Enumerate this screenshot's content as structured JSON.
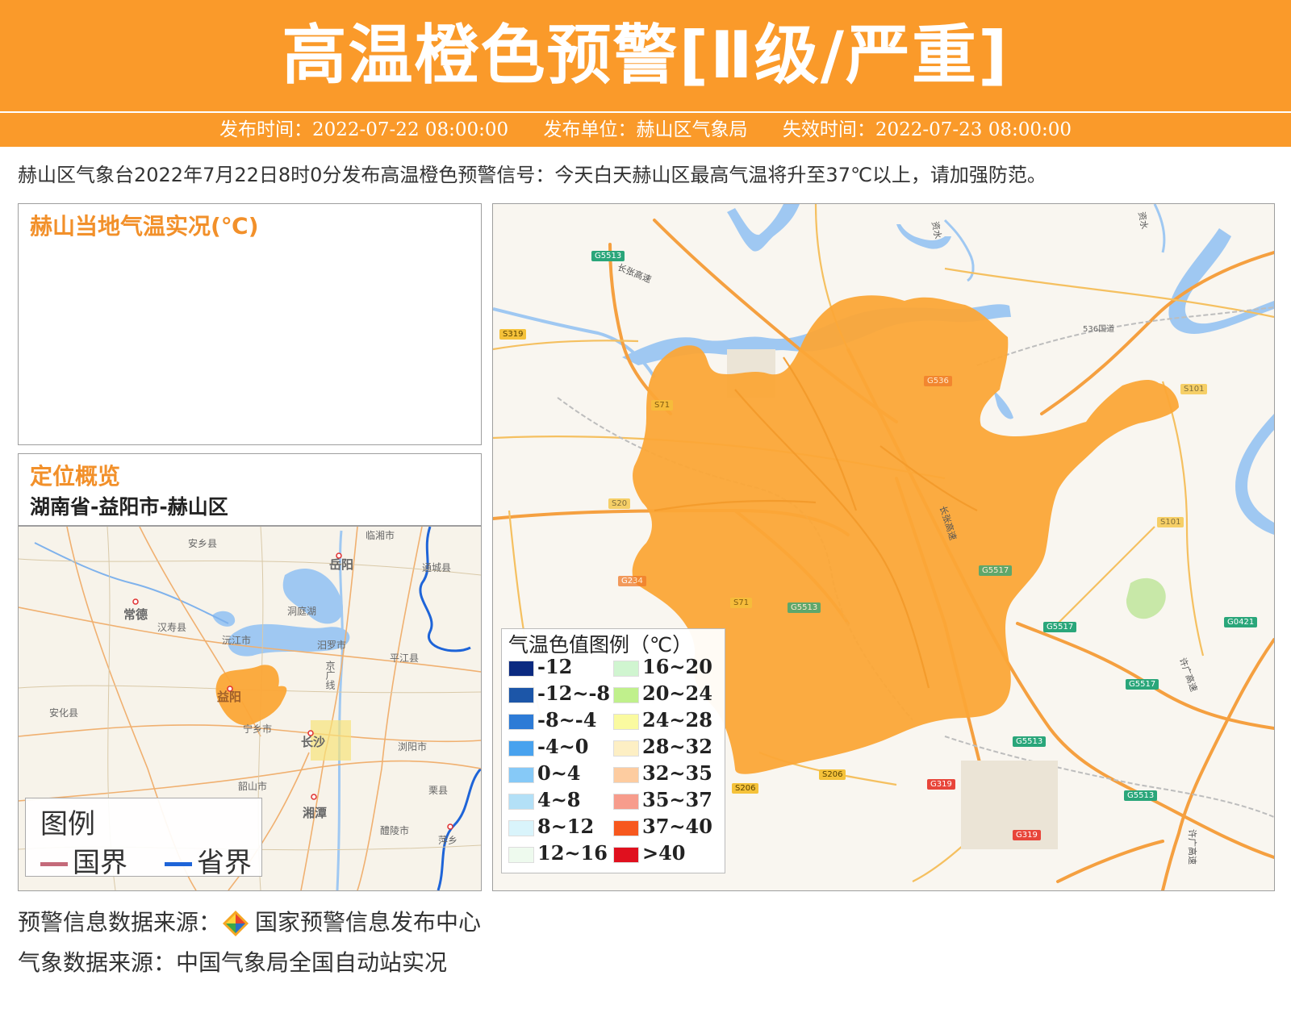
{
  "banner": {
    "title": "高温橙色预警[Ⅱ级/严重]",
    "publish_time": "发布时间：2022-07-22 08:00:00",
    "publisher": "发布单位：赫山区气象局",
    "expire_time": "失效时间：2022-07-23 08:00:00"
  },
  "description": "赫山区气象台2022年7月22日8时0分发布高温橙色预警信号：今天白天赫山区最高气温将升至37℃以上，请加强防范。",
  "temperature_panel": {
    "title": "赫山当地气温实况(℃)"
  },
  "location_panel": {
    "title": "定位概览",
    "region": "湖南省-益阳市-赫山区",
    "map_labels": [
      "安乡县",
      "常德",
      "汉寿县",
      "洞庭湖",
      "沅江市",
      "汨罗市",
      "平江县",
      "岳阳",
      "通城县",
      "临湘市",
      "益阳",
      "安化县",
      "宁乡市",
      "长沙",
      "浏阳市",
      "韶山市",
      "湘潭",
      "醴陵市",
      "萍乡",
      "栗县",
      "京广线"
    ],
    "legend": {
      "title": "图例",
      "items": [
        {
          "label": "国界",
          "color": "#c46a7a"
        },
        {
          "label": "省界",
          "color": "#1e64d8"
        }
      ]
    }
  },
  "main_map": {
    "road_labels": [
      "G5513",
      "S319",
      "S71",
      "G536",
      "S101",
      "S20",
      "G5513",
      "S101",
      "G234",
      "S71",
      "G5517",
      "G5517",
      "G0421",
      "G5517",
      "G5513",
      "S206",
      "S206",
      "G319",
      "G5513",
      "G319",
      "536国道"
    ],
    "road_text": [
      "长张高速",
      "长张高速",
      "许广高速",
      "许广高速",
      "资水",
      "资水"
    ],
    "warning_area_color": "#fba637",
    "legend": {
      "title": "气温色值图例（℃）",
      "items": [
        {
          "label": "-12",
          "color": "#0b2a80"
        },
        {
          "label": "-12~-8",
          "color": "#1c56a8"
        },
        {
          "label": "-8~-4",
          "color": "#2d7bd6"
        },
        {
          "label": "-4~0",
          "color": "#48a2ee"
        },
        {
          "label": "0~4",
          "color": "#86c9f7"
        },
        {
          "label": "4~8",
          "color": "#b3e0f7"
        },
        {
          "label": "8~12",
          "color": "#d9f4fb"
        },
        {
          "label": "12~16",
          "color": "#eefaee"
        },
        {
          "label": "16~20",
          "color": "#d0f5d0"
        },
        {
          "label": "20~24",
          "color": "#c0f08c"
        },
        {
          "label": "24~28",
          "color": "#fafaa0"
        },
        {
          "label": "28~32",
          "color": "#fdefc4"
        },
        {
          "label": "32~35",
          "color": "#fdcca0"
        },
        {
          "label": "35~37",
          "color": "#f79c8c"
        },
        {
          "label": "37~40",
          "color": "#f7581e"
        },
        {
          "label": ">40",
          "color": "#e0101e"
        }
      ]
    }
  },
  "footer": {
    "warning_source_label": "预警信息数据来源：",
    "warning_source_name": "国家预警信息发布中心",
    "weather_source": "气象数据来源：中国气象局全国自动站实况"
  }
}
